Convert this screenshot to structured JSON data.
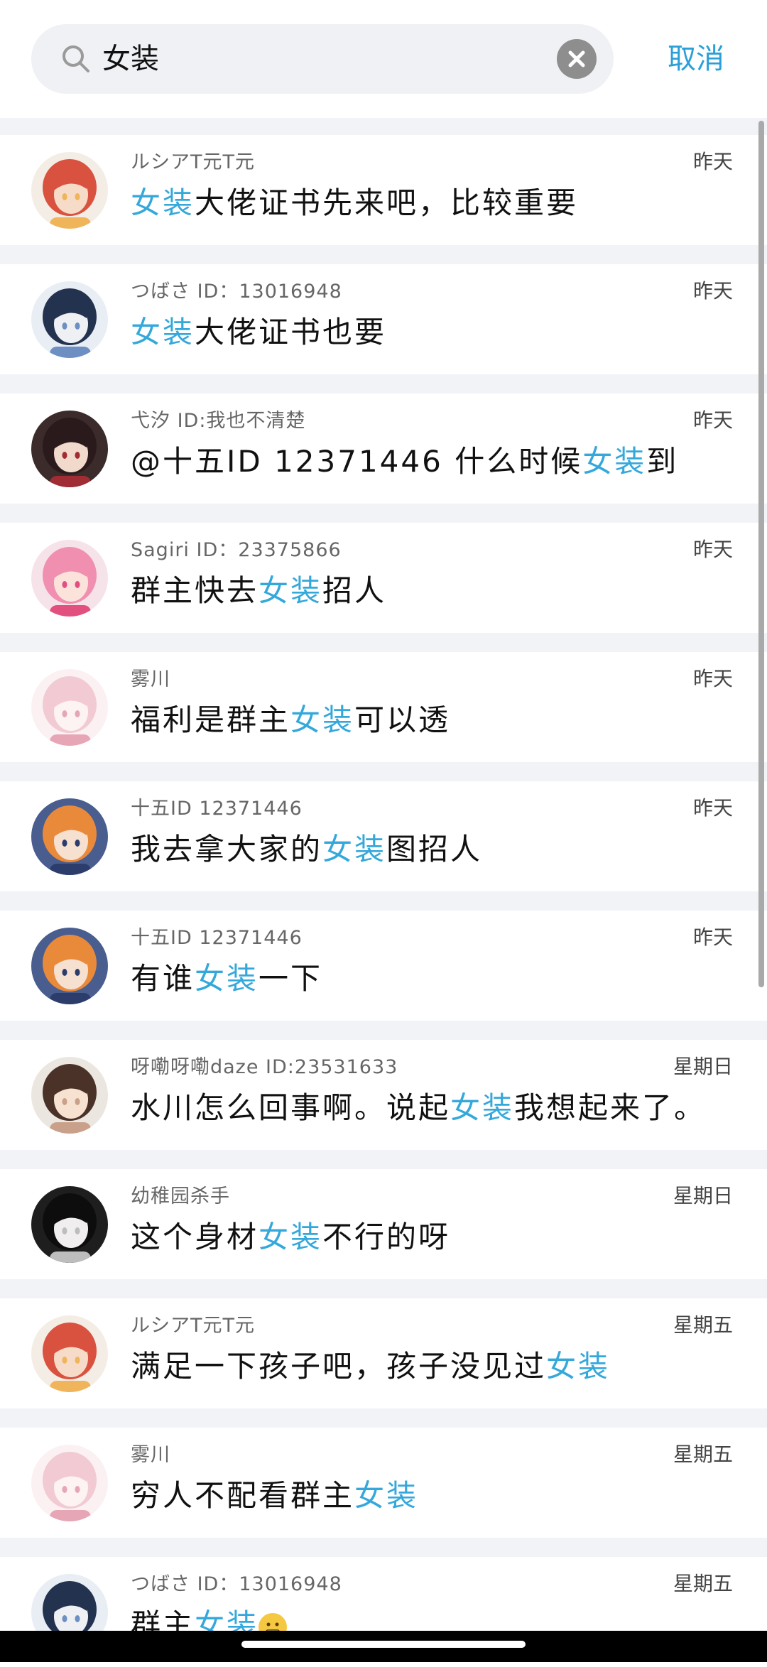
{
  "search": {
    "query": "女装",
    "cancel_label": "取消"
  },
  "messages": [
    {
      "name": "ルシアT元T元",
      "time": "昨天",
      "parts": [
        "",
        "女装",
        "大佬证书先来吧，比较重要"
      ],
      "avatar": "avatar-red-hair"
    },
    {
      "name": "つばさ ID：13016948",
      "time": "昨天",
      "parts": [
        "",
        "女装",
        "大佬证书也要"
      ],
      "avatar": "avatar-dark-blue-hair"
    },
    {
      "name": "弋汐 ID:我也不清楚",
      "time": "昨天",
      "parts": [
        "@十五ID 12371446 什么时候",
        "女装",
        "到"
      ],
      "avatar": "avatar-dark-red-hair"
    },
    {
      "name": "Sagiri ID：23375866",
      "time": "昨天",
      "parts": [
        "群主快去",
        "女装",
        "招人"
      ],
      "avatar": "avatar-pink-hair"
    },
    {
      "name": "雾川",
      "time": "昨天",
      "parts": [
        "福利是群主",
        "女装",
        "可以透"
      ],
      "avatar": "avatar-white-pink"
    },
    {
      "name": "十五ID 12371446",
      "time": "昨天",
      "parts": [
        "我去拿大家的",
        "女装",
        "图招人"
      ],
      "avatar": "avatar-orange-hair"
    },
    {
      "name": "十五ID 12371446",
      "time": "昨天",
      "parts": [
        "有谁",
        "女装",
        "一下"
      ],
      "avatar": "avatar-orange-hair"
    },
    {
      "name": "呀嘞呀嘞daze ID:23531633",
      "time": "星期日",
      "parts": [
        "水川怎么回事啊。说起",
        "女装",
        "我想起来了。"
      ],
      "avatar": "avatar-brown-hair"
    },
    {
      "name": "幼稚园杀手",
      "time": "星期日",
      "parts": [
        "这个身材",
        "女装",
        "不行的呀"
      ],
      "avatar": "avatar-black-white"
    },
    {
      "name": "ルシアT元T元",
      "time": "星期五",
      "parts": [
        "满足一下孩子吧，孩子没见过",
        "女装",
        ""
      ],
      "avatar": "avatar-red-hair"
    },
    {
      "name": "雾川",
      "time": "星期五",
      "parts": [
        "穷人不配看群主",
        "女装",
        ""
      ],
      "avatar": "avatar-white-pink"
    },
    {
      "name": "つばさ ID：13016948",
      "time": "星期五",
      "parts": [
        "群主",
        "女装",
        ""
      ],
      "avatar": "avatar-dark-blue-hair",
      "emoji": "grimace-emoji"
    }
  ],
  "colors": {
    "highlight": "#35a8db",
    "cancel": "#2a9fd8",
    "background": "#f2f3f7"
  }
}
